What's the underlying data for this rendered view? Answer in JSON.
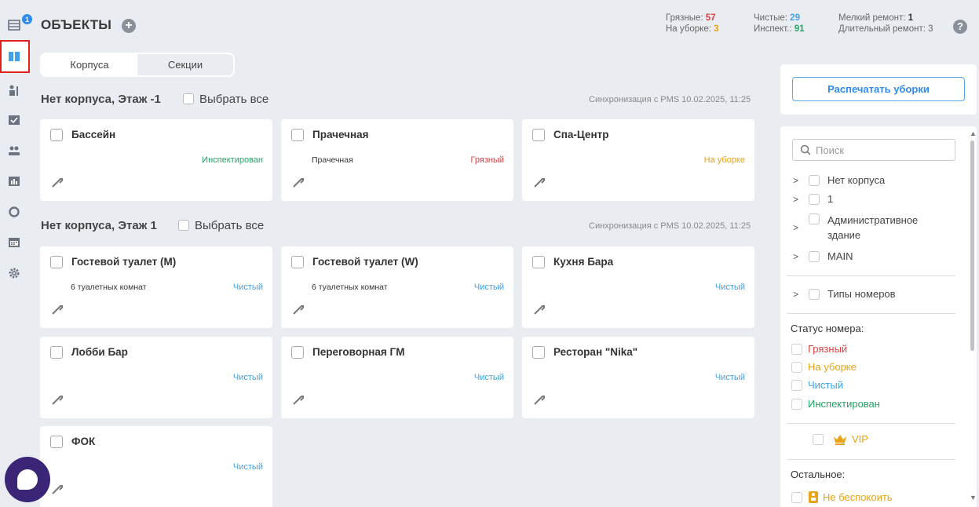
{
  "header": {
    "title": "ОБЪЕКТЫ",
    "add_icon": "plus-circle-icon",
    "help_icon": "question-circle-icon",
    "stats": {
      "dirty_label": "Грязные:",
      "dirty_value": "57",
      "cleaning_label": "На уборке:",
      "cleaning_value": "3",
      "clean_label": "Чистые:",
      "clean_value": "29",
      "inspected_label": "Инспект.:",
      "inspected_value": "91",
      "minor_repair_label": "Мелкий ремонт:",
      "minor_repair_value": "1",
      "long_repair_label": "Длительный ремонт:",
      "long_repair_value": "3"
    }
  },
  "sidebar": {
    "badge": "1",
    "items": [
      {
        "icon": "list-icon"
      },
      {
        "icon": "grid-icon",
        "active": true
      },
      {
        "icon": "housekeeping-icon"
      },
      {
        "icon": "tasks-check-icon"
      },
      {
        "icon": "users-icon"
      },
      {
        "icon": "bar-chart-icon"
      },
      {
        "icon": "circle-icon"
      },
      {
        "icon": "calendar-icon"
      },
      {
        "icon": "gear-icon"
      }
    ]
  },
  "tabs": [
    {
      "label": "Корпуса",
      "active": true
    },
    {
      "label": "Секции",
      "active": false
    }
  ],
  "sections": [
    {
      "title": "Нет корпуса, Этаж -1",
      "select_all": "Выбрать все",
      "sync": "Синхронизация с PMS 10.02.2025, 11:25",
      "cards": [
        {
          "name": "Бассейн",
          "sub": "",
          "status": "Инспектирован",
          "status_key": "insp"
        },
        {
          "name": "Прачечная",
          "sub": "Прачечная",
          "status": "Грязный",
          "status_key": "dirty"
        },
        {
          "name": "Спа-Центр",
          "sub": "",
          "status": "На уборке",
          "status_key": "cleaning"
        }
      ]
    },
    {
      "title": "Нет корпуса, Этаж 1",
      "select_all": "Выбрать все",
      "sync": "Синхронизация с PMS 10.02.2025, 11:25",
      "cards": [
        {
          "name": "Гостевой туалет (М)",
          "sub": "6 туалетных комнат",
          "status": "Чистый",
          "status_key": "clean"
        },
        {
          "name": "Гостевой туалет (W)",
          "sub": "6 туалетных комнат",
          "status": "Чистый",
          "status_key": "clean"
        },
        {
          "name": "Кухня Бара",
          "sub": "",
          "status": "Чистый",
          "status_key": "clean"
        },
        {
          "name": "Лобби Бар",
          "sub": "",
          "status": "Чистый",
          "status_key": "clean"
        },
        {
          "name": "Переговорная ГМ",
          "sub": "",
          "status": "Чистый",
          "status_key": "clean"
        },
        {
          "name": "Ресторан \"Nika\"",
          "sub": "",
          "status": "Чистый",
          "status_key": "clean"
        },
        {
          "name": "ФОК",
          "sub": "",
          "status": "Чистый",
          "status_key": "clean"
        }
      ]
    }
  ],
  "right_panel": {
    "print_button": "Распечатать уборки",
    "search_placeholder": "Поиск",
    "tree": [
      {
        "label": "Нет корпуса"
      },
      {
        "label": "1"
      },
      {
        "label": "Административное здание"
      },
      {
        "label": "MAIN"
      }
    ],
    "room_types": "Типы номеров",
    "status_title": "Статус номера:",
    "statuses": [
      {
        "label": "Грязный",
        "color": "#e04040"
      },
      {
        "label": "На уборке",
        "color": "#e8a316"
      },
      {
        "label": "Чистый",
        "color": "#3fa2e8"
      },
      {
        "label": "Инспектирован",
        "color": "#23a566"
      }
    ],
    "vip_label": "VIP",
    "other_title": "Остальное:",
    "dnd_label": "Не беспокоить"
  },
  "colors": {
    "accent": "#2d8cf0",
    "dirty": "#e04040",
    "cleaning": "#e8a316",
    "clean": "#3fa2e8",
    "inspected": "#23a566",
    "chat": "#3b2577"
  }
}
